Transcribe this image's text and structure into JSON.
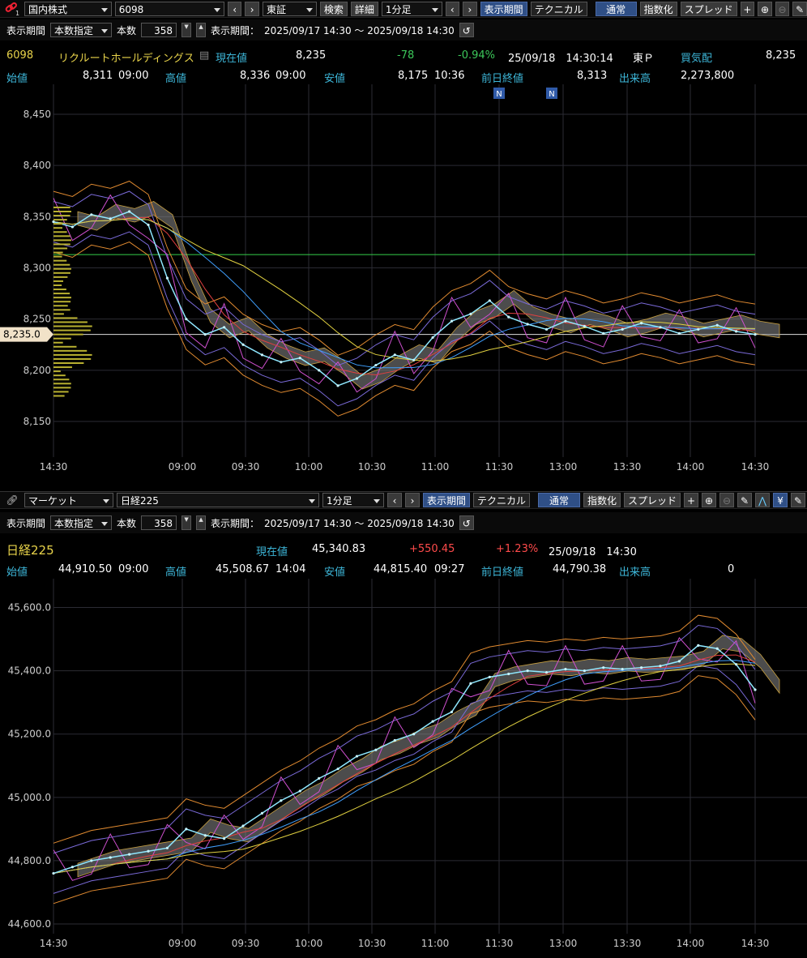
{
  "colors": {
    "label": "#3db6d8",
    "up": "#ff4b4b",
    "down": "#3cc85a",
    "name": "#e8d34a",
    "grid": "#2b2b33"
  },
  "top": {
    "toolbar": {
      "market_select": "国内株式",
      "code_input": "6098",
      "exchange_select": "東証",
      "search_button": "検索",
      "detail_button": "詳細",
      "interval_select": "1分足",
      "period_button": "表示期間",
      "technical_button": "テクニカル",
      "normal_button": "通常",
      "index_button": "指数化",
      "spread_button": "スプレッド"
    },
    "period_row": {
      "label": "表示期間",
      "mode_select": "本数指定",
      "count_label": "本数",
      "count_value": "358",
      "range_label": "表示期間：",
      "range": "2025/09/17 14:30 〜 2025/09/18 14:30"
    },
    "quote": {
      "code": "6098",
      "name": "リクルートホールディングス",
      "current_label": "現在値",
      "current": "8,235",
      "change": "-78",
      "change_pct": "-0.94%",
      "datetime": "25/09/18　14:30:14",
      "market": "東Ｐ",
      "bid_label": "買気配",
      "bid": "8,235"
    },
    "ohlc": {
      "open_label": "始値",
      "open": "8,311",
      "open_time": "09:00",
      "high_label": "高値",
      "high": "8,336",
      "high_time": "09:00",
      "low_label": "安値",
      "low": "8,175",
      "low_time": "10:36",
      "prev_label": "前日終値",
      "prev": "8,313",
      "vol_label": "出来高",
      "vol": "2,273,800"
    },
    "news_markers": [
      "N",
      "N"
    ],
    "price_tag": "8,235.0"
  },
  "bottom": {
    "toolbar": {
      "market_select": "マーケット",
      "index_select": "日経225",
      "interval_select": "1分足",
      "period_button": "表示期間",
      "technical_button": "テクニカル",
      "normal_button": "通常",
      "index_button": "指数化",
      "spread_button": "スプレッド"
    },
    "period_row": {
      "label": "表示期間",
      "mode_select": "本数指定",
      "count_label": "本数",
      "count_value": "358",
      "range_label": "表示期間：",
      "range": "2025/09/17 14:30 〜 2025/09/18 14:30"
    },
    "quote": {
      "name": "日経225",
      "current_label": "現在値",
      "current": "45,340.83",
      "change": "+550.45",
      "change_pct": "+1.23%",
      "datetime": "25/09/18　14:30"
    },
    "ohlc": {
      "open_label": "始値",
      "open": "44,910.50",
      "open_time": "09:00",
      "high_label": "高値",
      "high": "45,508.67",
      "high_time": "14:04",
      "low_label": "安値",
      "low": "44,815.40",
      "low_time": "09:27",
      "prev_label": "前日終値",
      "prev": "44,790.38",
      "vol_label": "出来高",
      "vol": "0"
    }
  },
  "chart_data": [
    {
      "type": "line",
      "title": "",
      "x_ticks": [
        "14:30",
        "09:00",
        "09:30",
        "10:00",
        "10:30",
        "11:00",
        "11:30",
        "13:00",
        "13:30",
        "14:00",
        "14:30"
      ],
      "y_ticks": [
        "8,450",
        "8,400",
        "8,350",
        "8,300",
        "8,250",
        "8,200",
        "8,150"
      ],
      "ylim": [
        8135,
        8465
      ],
      "reference_lines": [
        {
          "value": 8313,
          "color": "#35d04a"
        },
        {
          "value": 8235,
          "color": "#dddddd"
        }
      ],
      "series": [
        {
          "values": [
            8345,
            8340,
            8352,
            8348,
            8355,
            8342,
            8290,
            8250,
            8235,
            8242,
            8225,
            8215,
            8208,
            8212,
            8200,
            8185,
            8192,
            8205,
            8215,
            8210,
            8232,
            8248,
            8255,
            8268,
            8252,
            8245,
            8240,
            8248,
            8243,
            8236,
            8240,
            8246,
            8242,
            8236,
            8240,
            8244,
            8238,
            8235
          ]
        }
      ]
    },
    {
      "type": "line",
      "title": "",
      "x_ticks": [
        "14:30",
        "09:00",
        "09:30",
        "10:00",
        "10:30",
        "11:00",
        "11:30",
        "13:00",
        "13:30",
        "14:00",
        "14:30"
      ],
      "y_ticks": [
        "45,600.0",
        "45,400.0",
        "45,200.0",
        "45,000.0",
        "44,800.0",
        "44,600.0"
      ],
      "ylim": [
        44595,
        45655
      ],
      "series": [
        {
          "values": [
            44760,
            44780,
            44800,
            44810,
            44820,
            44830,
            44840,
            44900,
            44880,
            44870,
            44910,
            44950,
            44990,
            45020,
            45060,
            45090,
            45130,
            45150,
            45180,
            45200,
            45240,
            45270,
            45360,
            45380,
            45390,
            45400,
            45395,
            45405,
            45400,
            45410,
            45405,
            45410,
            45415,
            45430,
            45480,
            45470,
            45420,
            45340
          ]
        }
      ]
    }
  ]
}
